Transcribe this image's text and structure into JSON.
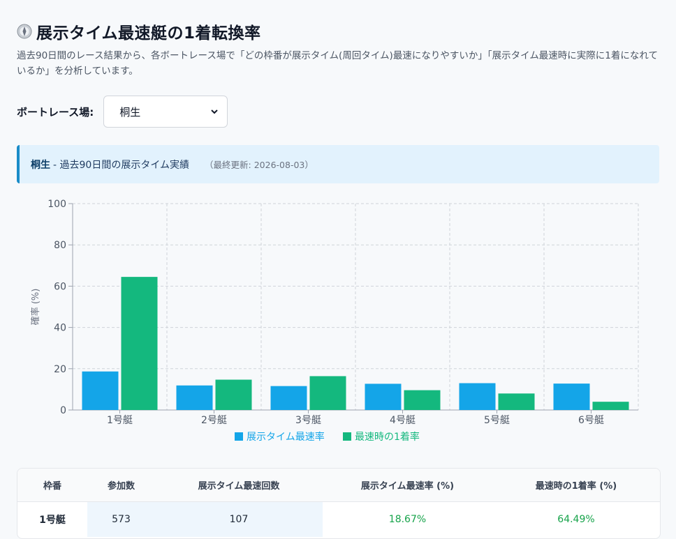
{
  "page": {
    "title": "展示タイム最速艇の1着転換率",
    "description": "過去90日間のレース結果から、各ボートレース場で「どの枠番が展示タイム(周回タイム)最速になりやすいか」「展示タイム最速時に実際に1着になれているか」を分析しています。"
  },
  "filter": {
    "label": "ボートレース場:",
    "selected": "桐生"
  },
  "info": {
    "venue": "桐生",
    "text": "- 過去90日間の展示タイム実績",
    "updated": "（最終更新: 2026-08-03）"
  },
  "colors": {
    "fastest_rate": "#14a5e8",
    "win_rate": "#14b87e"
  },
  "chart_data": {
    "type": "bar",
    "categories": [
      "1号艇",
      "2号艇",
      "3号艇",
      "4号艇",
      "5号艇",
      "6号艇"
    ],
    "series": [
      {
        "name": "展示タイム最速率",
        "values": [
          18.67,
          11.9,
          11.6,
          12.7,
          13.0,
          12.8
        ]
      },
      {
        "name": "最速時の1着率",
        "values": [
          64.49,
          14.7,
          16.4,
          9.6,
          8.0,
          4.0
        ]
      }
    ],
    "ylabel": "確率 (%)",
    "ylim": [
      0,
      100
    ],
    "yticks": [
      0,
      20,
      40,
      60,
      80,
      100
    ],
    "grid": true,
    "legend": "bottom"
  },
  "table": {
    "headers": [
      "枠番",
      "参加数",
      "展示タイム最速回数",
      "展示タイム最速率 (%)",
      "最速時の1着率 (%)"
    ],
    "rows": [
      [
        "1号艇",
        "573",
        "107",
        "18.67%",
        "64.49%"
      ]
    ]
  }
}
